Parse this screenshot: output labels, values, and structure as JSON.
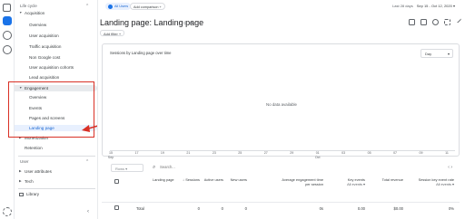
{
  "sidebar": {
    "header": "Life cycle",
    "items": [
      {
        "label": "Acquisition",
        "level": 1,
        "expanded": true
      },
      {
        "label": "Overview",
        "level": 2
      },
      {
        "label": "User acquisition",
        "level": 2
      },
      {
        "label": "Traffic acquisition",
        "level": 2
      },
      {
        "label": "Non Google cost",
        "level": 2
      },
      {
        "label": "User acquisition cohorts",
        "level": 2
      },
      {
        "label": "Lead acquisition",
        "level": 2
      },
      {
        "label": "Engagement",
        "level": 1,
        "expanded": true
      },
      {
        "label": "Overview",
        "level": 2
      },
      {
        "label": "Events",
        "level": 2
      },
      {
        "label": "Pages and screens",
        "level": 2
      },
      {
        "label": "Landing page",
        "level": 2,
        "active": true
      },
      {
        "label": "Monetization",
        "level": 1
      },
      {
        "label": "Retention",
        "level": 1
      }
    ],
    "user_section": "User",
    "user_items": [
      {
        "label": "User attributes"
      },
      {
        "label": "Tech"
      }
    ],
    "library": "Library"
  },
  "topbar": {
    "all_users": "All Users",
    "add_comparison": "Add comparison +",
    "date_label": "Last 28 days",
    "date_range": "Sep 15 - Oct 12, 2020"
  },
  "page": {
    "title": "Landing page: Landing page",
    "add_filter": "Add filter +"
  },
  "chart_card": {
    "title": "Sessions by Landing page over time",
    "granularity": "Day",
    "no_data": "No data available",
    "x_ticks": [
      {
        "day": "15",
        "month": "Sep"
      },
      {
        "day": "17",
        "month": ""
      },
      {
        "day": "19",
        "month": ""
      },
      {
        "day": "21",
        "month": ""
      },
      {
        "day": "23",
        "month": ""
      },
      {
        "day": "25",
        "month": ""
      },
      {
        "day": "27",
        "month": ""
      },
      {
        "day": "29",
        "month": ""
      },
      {
        "day": "01",
        "month": "Oct"
      },
      {
        "day": "03",
        "month": ""
      },
      {
        "day": "05",
        "month": ""
      },
      {
        "day": "07",
        "month": ""
      },
      {
        "day": "09",
        "month": ""
      },
      {
        "day": "11",
        "month": ""
      }
    ]
  },
  "table": {
    "rows_per_page": "Rows",
    "search_placeholder": "Search...",
    "columns": [
      {
        "label": "Landing page",
        "sub": ""
      },
      {
        "label": "↓ Sessions",
        "sub": ""
      },
      {
        "label": "Active users",
        "sub": ""
      },
      {
        "label": "New users",
        "sub": ""
      },
      {
        "label": "Average engagement time per session",
        "sub": ""
      },
      {
        "label": "Key events",
        "sub": "All events ▾"
      },
      {
        "label": "Total revenue",
        "sub": ""
      },
      {
        "label": "Session key event rate",
        "sub": "All events ▾"
      }
    ],
    "total_row": {
      "label": "Total",
      "values": [
        "0",
        "0",
        "0",
        "0s",
        "0.00",
        "$0.00",
        "0%"
      ]
    }
  }
}
